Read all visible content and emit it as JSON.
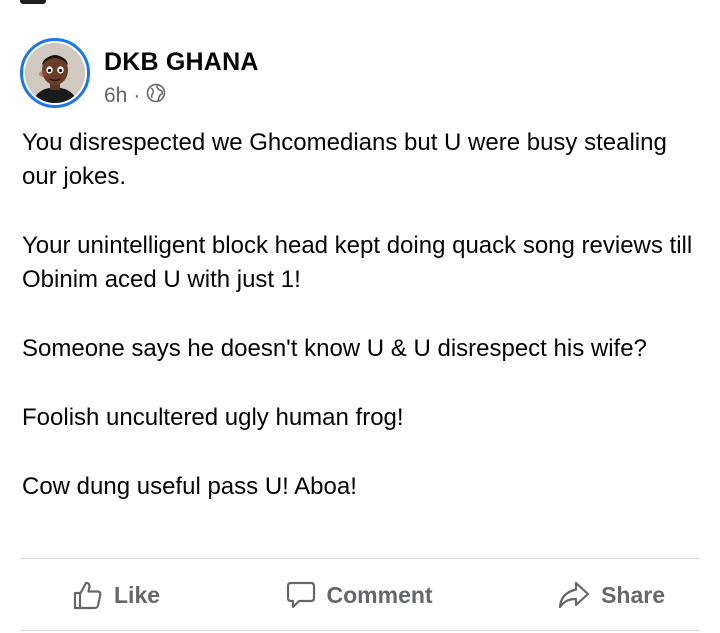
{
  "post": {
    "author": "DKB GHANA",
    "time": "6h",
    "separator": "·",
    "privacy_icon": "globe-icon",
    "paragraphs": [
      "You disrespected we Ghcomedians but U were busy stealing our jokes.",
      "Your unintelligent block head kept doing quack song reviews till Obinim aced U with just 1!",
      "Someone says he doesn't know U & U disrespect his wife?",
      "Foolish uncultered ugly human frog!",
      "Cow dung useful pass U! Aboa!"
    ]
  },
  "actions": {
    "like_label": "Like",
    "comment_label": "Comment",
    "share_label": "Share"
  },
  "colors": {
    "avatar_ring": "#1877f2",
    "secondary_text": "#65676b",
    "divider": "#dadde1"
  }
}
